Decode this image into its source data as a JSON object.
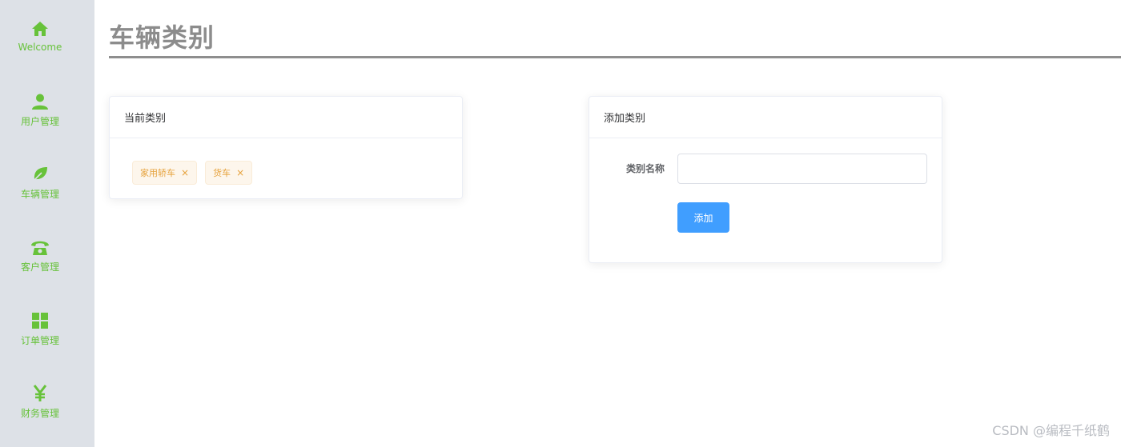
{
  "sidebar": {
    "items": [
      {
        "label": "Welcome",
        "icon": "home-icon"
      },
      {
        "label": "用户管理",
        "icon": "user-icon"
      },
      {
        "label": "车辆管理",
        "icon": "leaf-icon"
      },
      {
        "label": "客户管理",
        "icon": "phone-icon"
      },
      {
        "label": "订单管理",
        "icon": "grid-icon"
      },
      {
        "label": "财务管理",
        "icon": "yen-icon"
      }
    ],
    "accent_color": "#67c23a"
  },
  "page": {
    "title": "车辆类别"
  },
  "current_categories": {
    "header": "当前类别",
    "tags": [
      {
        "label": "家用轿车",
        "close": "×"
      },
      {
        "label": "货车",
        "close": "×"
      }
    ]
  },
  "add_category": {
    "header": "添加类别",
    "field_label": "类别名称",
    "field_value": "",
    "field_placeholder": "",
    "button_label": "添加",
    "button_color": "#409eff"
  },
  "watermark": "CSDN @编程千纸鹤"
}
